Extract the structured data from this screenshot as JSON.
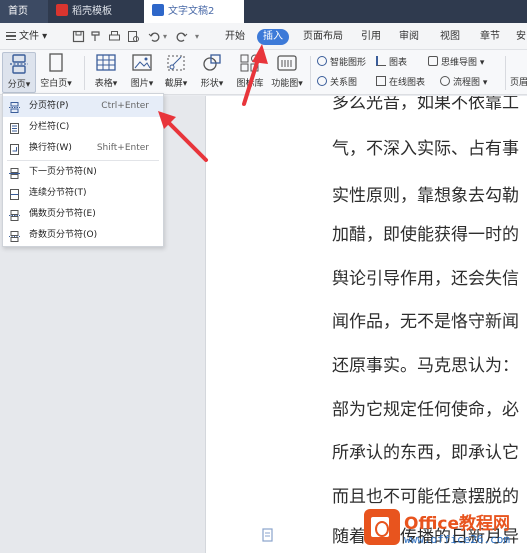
{
  "tabs": [
    {
      "label": "首页"
    },
    {
      "label": "稻壳模板"
    },
    {
      "label": "文字文稿2"
    }
  ],
  "menu": {
    "file": "文件",
    "items": [
      "开始",
      "插入",
      "页面布局",
      "引用",
      "审阅",
      "视图",
      "章节",
      "安"
    ],
    "active": "插入"
  },
  "ribbon": {
    "buttons": [
      "分页",
      "空白页",
      "表格",
      "图片",
      "截屏",
      "形状",
      "图标库",
      "功能图"
    ],
    "small": [
      "智能图形",
      "图表",
      "思维导图",
      "关系图",
      "在线图表",
      "流程图"
    ],
    "right_cut": "页眉"
  },
  "dropdown": {
    "items": [
      {
        "label": "分页符(P)",
        "shortcut": "Ctrl+Enter"
      },
      {
        "label": "分栏符(C)",
        "shortcut": ""
      },
      {
        "label": "换行符(W)",
        "shortcut": "Shift+Enter"
      },
      {
        "label": "下一页分节符(N)",
        "shortcut": ""
      },
      {
        "label": "连续分节符(T)",
        "shortcut": ""
      },
      {
        "label": "偶数页分节符(E)",
        "shortcut": ""
      },
      {
        "label": "奇数页分节符(O)",
        "shortcut": ""
      }
    ]
  },
  "document": {
    "lines": [
      "多么光音，如果不依靠工",
      "气，不深入实际、占有事",
      "实性原则，靠想象去勾勒",
      "加醋，即使能获得一时的",
      "舆论引导作用，还会失信",
      "闻作品，无不是恪守新闻",
      "还原事实。马克思认为：",
      "部为它规定任何使命，必",
      "所承认的东西，即承认它",
      "而且也不可能任意摆脱的",
      "随着新闻传播的日新月异"
    ]
  },
  "watermark": {
    "title": "Office教程网",
    "url": "www.office26.com"
  },
  "colors": {
    "tabbar": "#2f3a4e",
    "accent": "#3d7ad8",
    "arrow": "#e8353b",
    "watermark_orange": "#e8541e"
  }
}
